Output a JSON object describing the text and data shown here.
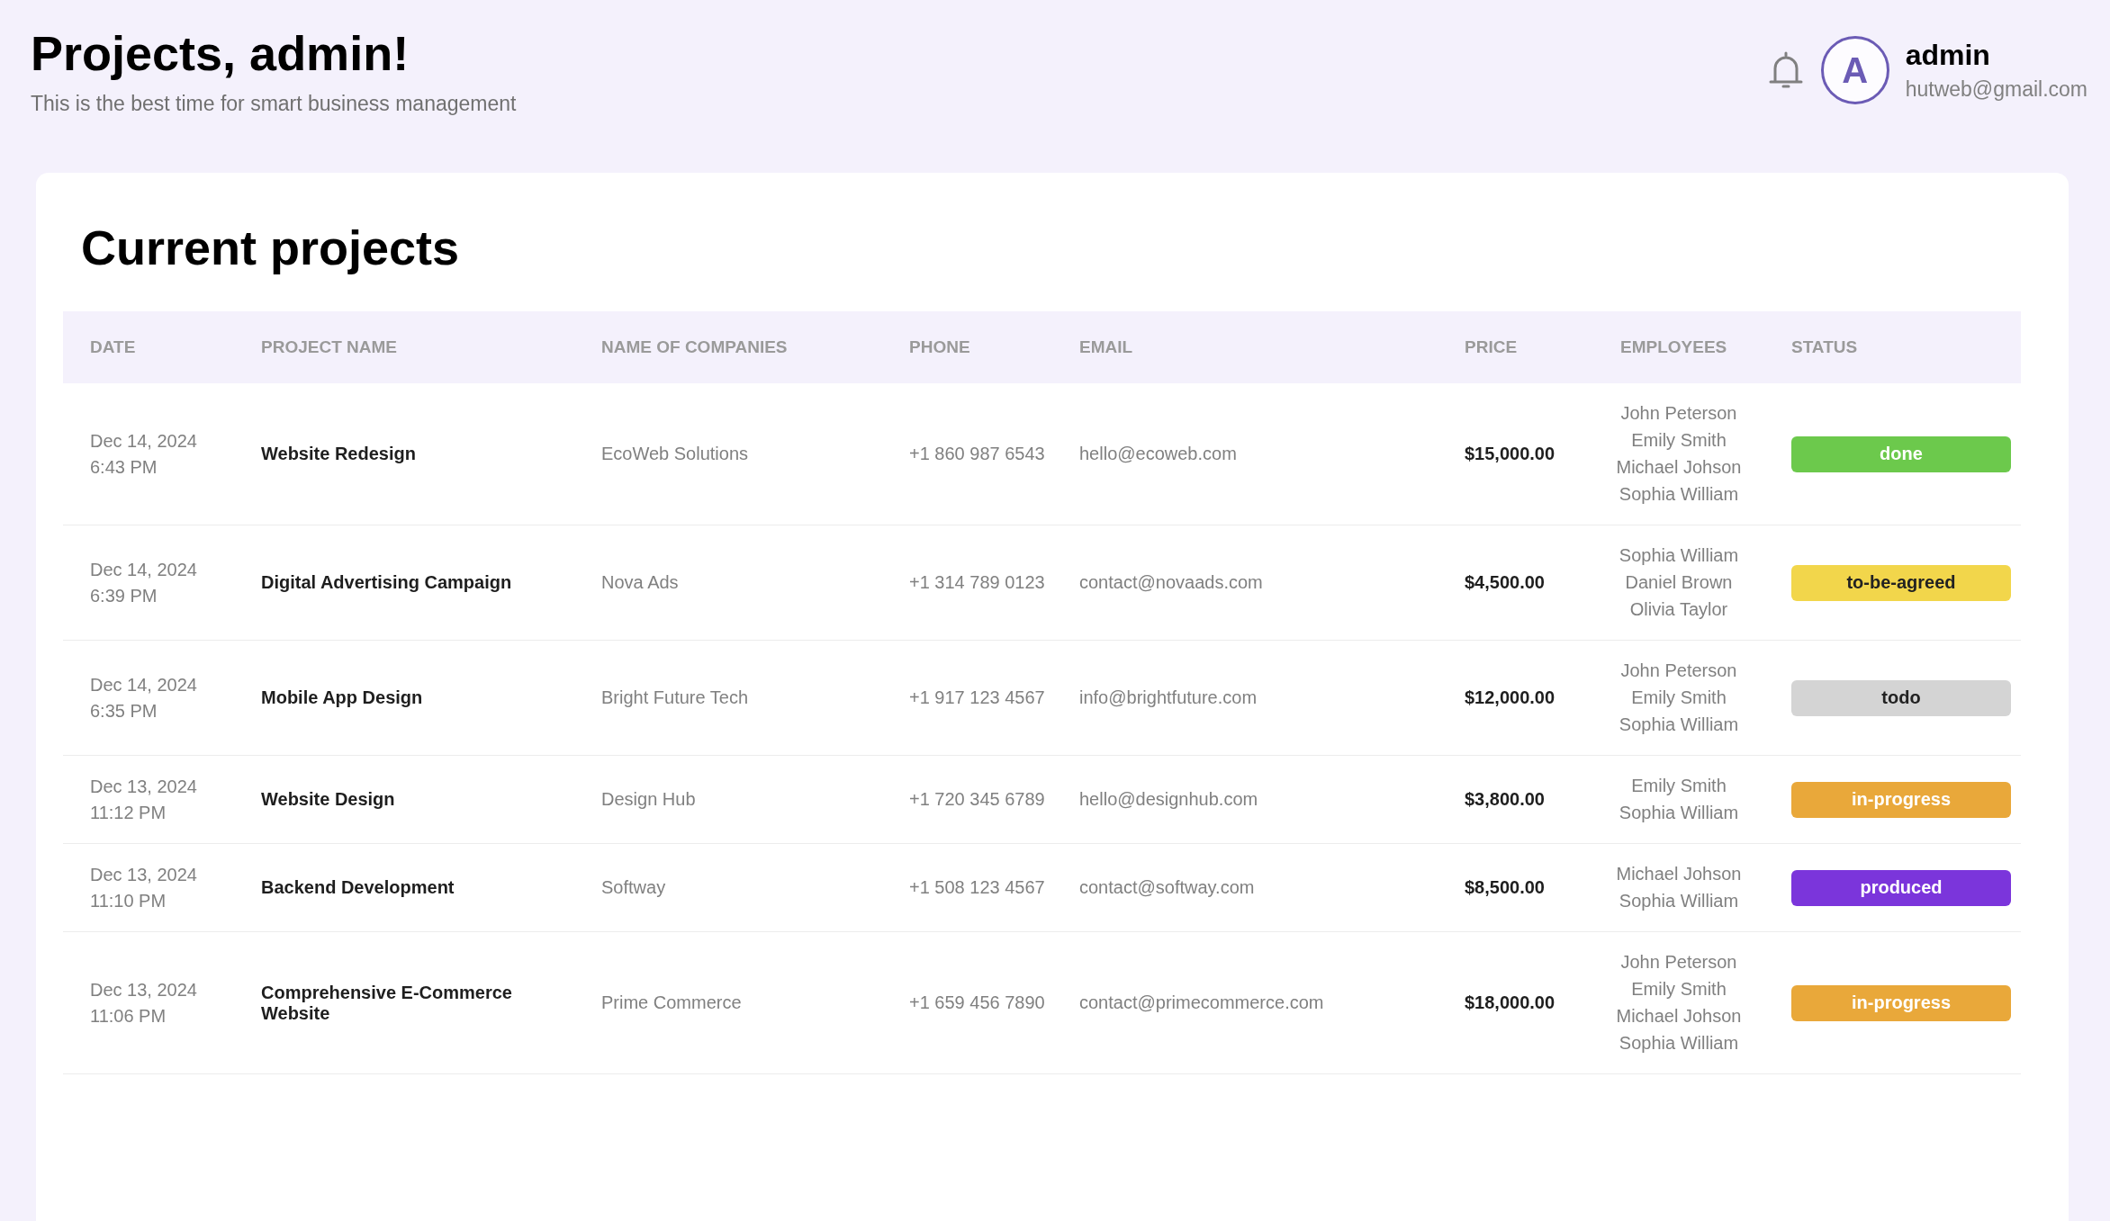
{
  "header": {
    "title": "Projects, admin!",
    "subtitle": "This is the best time for smart business management",
    "user": {
      "initial": "A",
      "name": "admin",
      "email": "hutweb@gmail.com"
    }
  },
  "card": {
    "title": "Current projects",
    "table": {
      "columns": [
        "DATE",
        "PROJECT NAME",
        "NAME OF COMPANIES",
        "PHONE",
        "EMAIL",
        "PRICE",
        "EMPLOYEES",
        "STATUS"
      ],
      "rows": [
        {
          "date": "Dec 14, 2024",
          "time": "6:43 PM",
          "project": "Website Redesign",
          "company": "EcoWeb Solutions",
          "phone": "+1 860 987 6543",
          "email": "hello@ecoweb.com",
          "price": "$15,000.00",
          "employees": [
            "John Peterson",
            "Emily Smith",
            "Michael Johson",
            "Sophia William"
          ],
          "status": {
            "label": "done",
            "color": "#6cc94c"
          }
        },
        {
          "date": "Dec 14, 2024",
          "time": "6:39 PM",
          "project": "Digital Advertising Campaign",
          "company": "Nova Ads",
          "phone": "+1 314 789 0123",
          "email": "contact@novaads.com",
          "price": "$4,500.00",
          "employees": [
            "Sophia William",
            "Daniel Brown",
            "Olivia Taylor"
          ],
          "status": {
            "label": "to-be-agreed",
            "color": "#f2d64b"
          }
        },
        {
          "date": "Dec 14, 2024",
          "time": "6:35 PM",
          "project": "Mobile App Design",
          "company": "Bright Future Tech",
          "phone": "+1 917 123 4567",
          "email": "info@brightfuture.com",
          "price": "$12,000.00",
          "employees": [
            "John Peterson",
            "Emily Smith",
            "Sophia William"
          ],
          "status": {
            "label": "todo",
            "color": "#d4d4d4"
          }
        },
        {
          "date": "Dec 13, 2024",
          "time": "11:12 PM",
          "project": "Website Design",
          "company": "Design Hub",
          "phone": "+1 720 345 6789",
          "email": "hello@designhub.com",
          "price": "$3,800.00",
          "employees": [
            "Emily Smith",
            "Sophia William"
          ],
          "status": {
            "label": "in-progress",
            "color": "#e9a83a"
          }
        },
        {
          "date": "Dec 13, 2024",
          "time": "11:10 PM",
          "project": "Backend Development",
          "company": "Softway",
          "phone": "+1 508 123 4567",
          "email": "contact@softway.com",
          "price": "$8,500.00",
          "employees": [
            "Michael Johson",
            "Sophia William"
          ],
          "status": {
            "label": "produced",
            "color": "#7b35db"
          }
        },
        {
          "date": "Dec 13, 2024",
          "time": "11:06 PM",
          "project": "Comprehensive E-Commerce Website",
          "company": "Prime Commerce",
          "phone": "+1 659 456 7890",
          "email": "contact@primecommerce.com",
          "price": "$18,000.00",
          "employees": [
            "John Peterson",
            "Emily Smith",
            "Michael Johson",
            "Sophia William"
          ],
          "status": {
            "label": "in-progress",
            "color": "#e9a83a"
          }
        }
      ]
    }
  }
}
